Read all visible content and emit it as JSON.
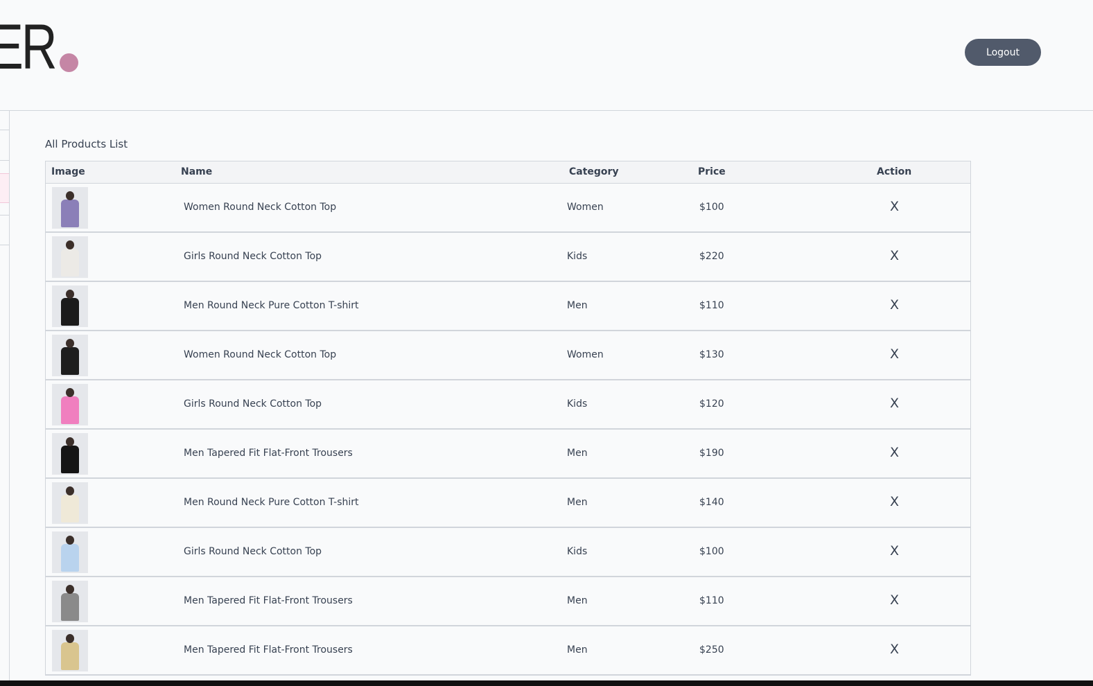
{
  "header": {
    "logo_text": "ER",
    "logout_label": "Logout"
  },
  "colors": {
    "accent_dot": "#c586a5",
    "logout_bg": "#515a6b"
  },
  "page_title": "All Products List",
  "table": {
    "columns": [
      "Image",
      "Name",
      "Category",
      "Price",
      "Action"
    ],
    "rows": [
      {
        "name": "Women Round Neck Cotton Top",
        "category": "Women",
        "price": "$100",
        "action": "X",
        "thumb_color": "#8b7fb8"
      },
      {
        "name": "Girls Round Neck Cotton Top",
        "category": "Kids",
        "price": "$220",
        "action": "X",
        "thumb_color": "#eceae6"
      },
      {
        "name": "Men Round Neck Pure Cotton T-shirt",
        "category": "Men",
        "price": "$110",
        "action": "X",
        "thumb_color": "#1b1b1b"
      },
      {
        "name": "Women Round Neck Cotton Top",
        "category": "Women",
        "price": "$130",
        "action": "X",
        "thumb_color": "#1e1e1e"
      },
      {
        "name": "Girls Round Neck Cotton Top",
        "category": "Kids",
        "price": "$120",
        "action": "X",
        "thumb_color": "#f07fbf"
      },
      {
        "name": "Men Tapered Fit Flat-Front Trousers",
        "category": "Men",
        "price": "$190",
        "action": "X",
        "thumb_color": "#151515"
      },
      {
        "name": "Men Round Neck Pure Cotton T-shirt",
        "category": "Men",
        "price": "$140",
        "action": "X",
        "thumb_color": "#efe9d8"
      },
      {
        "name": "Girls Round Neck Cotton Top",
        "category": "Kids",
        "price": "$100",
        "action": "X",
        "thumb_color": "#b9d3ee"
      },
      {
        "name": "Men Tapered Fit Flat-Front Trousers",
        "category": "Men",
        "price": "$110",
        "action": "X",
        "thumb_color": "#8a8a8a"
      },
      {
        "name": "Men Tapered Fit Flat-Front Trousers",
        "category": "Men",
        "price": "$250",
        "action": "X",
        "thumb_color": "#d9c58f"
      }
    ]
  }
}
